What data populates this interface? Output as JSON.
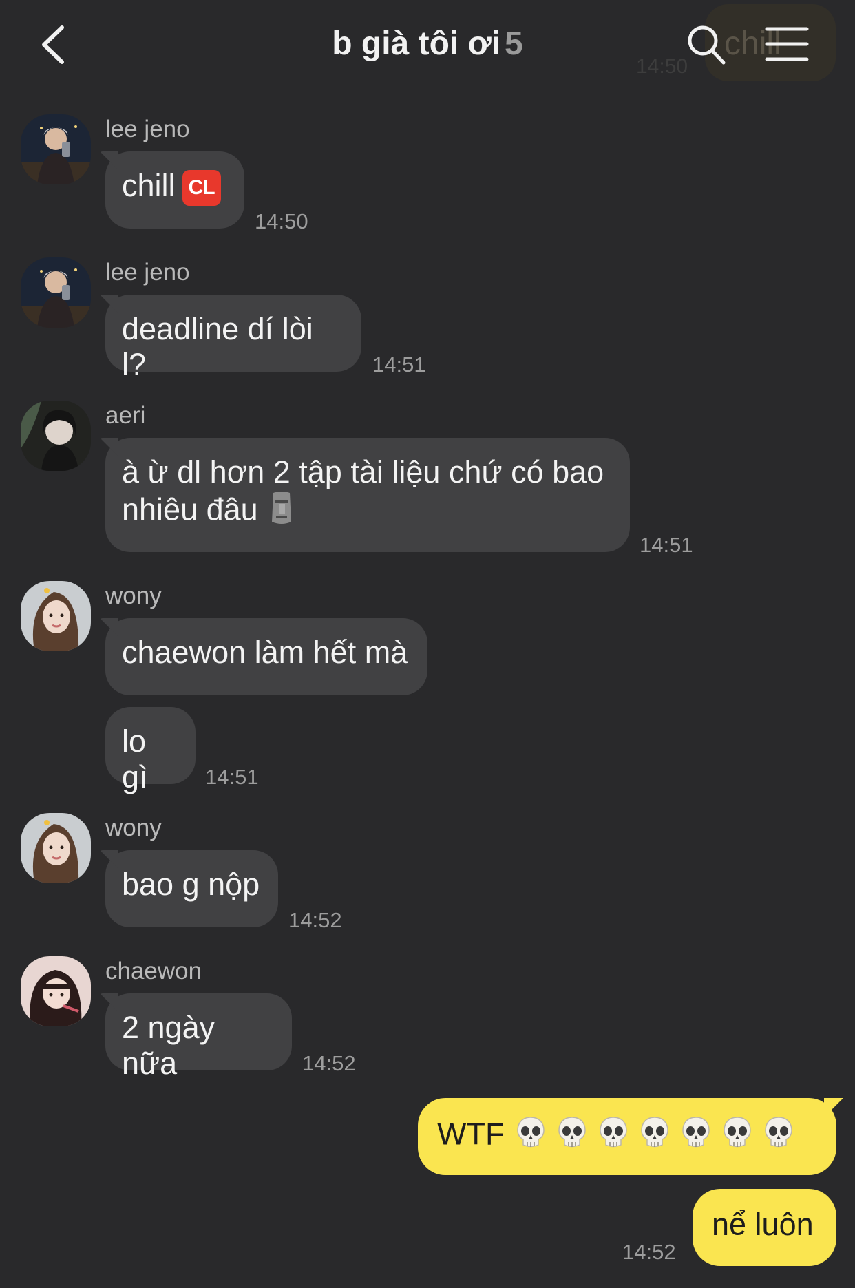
{
  "header": {
    "title": "b già tôi ơi",
    "member_count": "5",
    "back_icon": "chevron-left-icon",
    "search_icon": "search-icon",
    "menu_icon": "hamburger-menu-icon",
    "ghost_bubble_text": "chill",
    "ghost_time": "14:50"
  },
  "messages": [
    {
      "sender": "lee jeno",
      "text": "chill",
      "badge": "CL",
      "time": "14:50"
    },
    {
      "sender": "lee jeno",
      "text": "deadline dí lòi l?",
      "time": "14:51"
    },
    {
      "sender": "aeri",
      "line1": "à ừ dl hơn 2 tập tài liệu chứ có bao",
      "line2": "nhiêu đâu",
      "emoji": "moai-icon",
      "time": "14:51"
    },
    {
      "sender": "wony",
      "text": "chaewon làm hết mà",
      "text2": "lo gì",
      "time": "14:51"
    },
    {
      "sender": "wony",
      "text": "bao g nộp",
      "time": "14:52"
    },
    {
      "sender": "chaewon",
      "text": "2 ngày nữa",
      "time": "14:52"
    }
  ],
  "my_messages": [
    {
      "text": "WTF",
      "emoji": "skull-icon",
      "emoji_count": 7
    },
    {
      "text": "nể luôn",
      "time": "14:52"
    }
  ],
  "colors": {
    "background": "#29292b",
    "incoming_bubble": "#414143",
    "outgoing_bubble": "#fae550",
    "timestamp": "#9d9d9d"
  }
}
